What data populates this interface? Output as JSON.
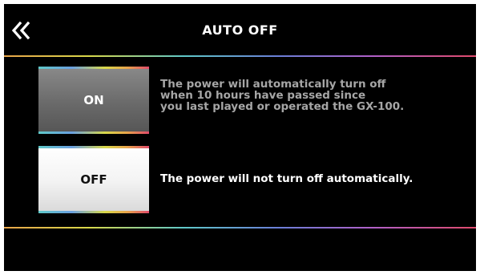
{
  "header": {
    "title": "AUTO OFF",
    "back_icon": "double-chevron-left-icon"
  },
  "options": {
    "on": {
      "label": "ON",
      "description": "The power will automatically turn off\nwhen 10 hours have passed since\nyou last played or operated the GX-100.",
      "selected": false
    },
    "off": {
      "label": "OFF",
      "description": "The power will not turn off automatically.",
      "selected": true
    }
  },
  "colors": {
    "background": "#000000",
    "selected_button": "#ffffff",
    "unselected_button": "#6a6a6a",
    "inactive_text": "#a6a6a6",
    "active_text": "#ffffff"
  }
}
